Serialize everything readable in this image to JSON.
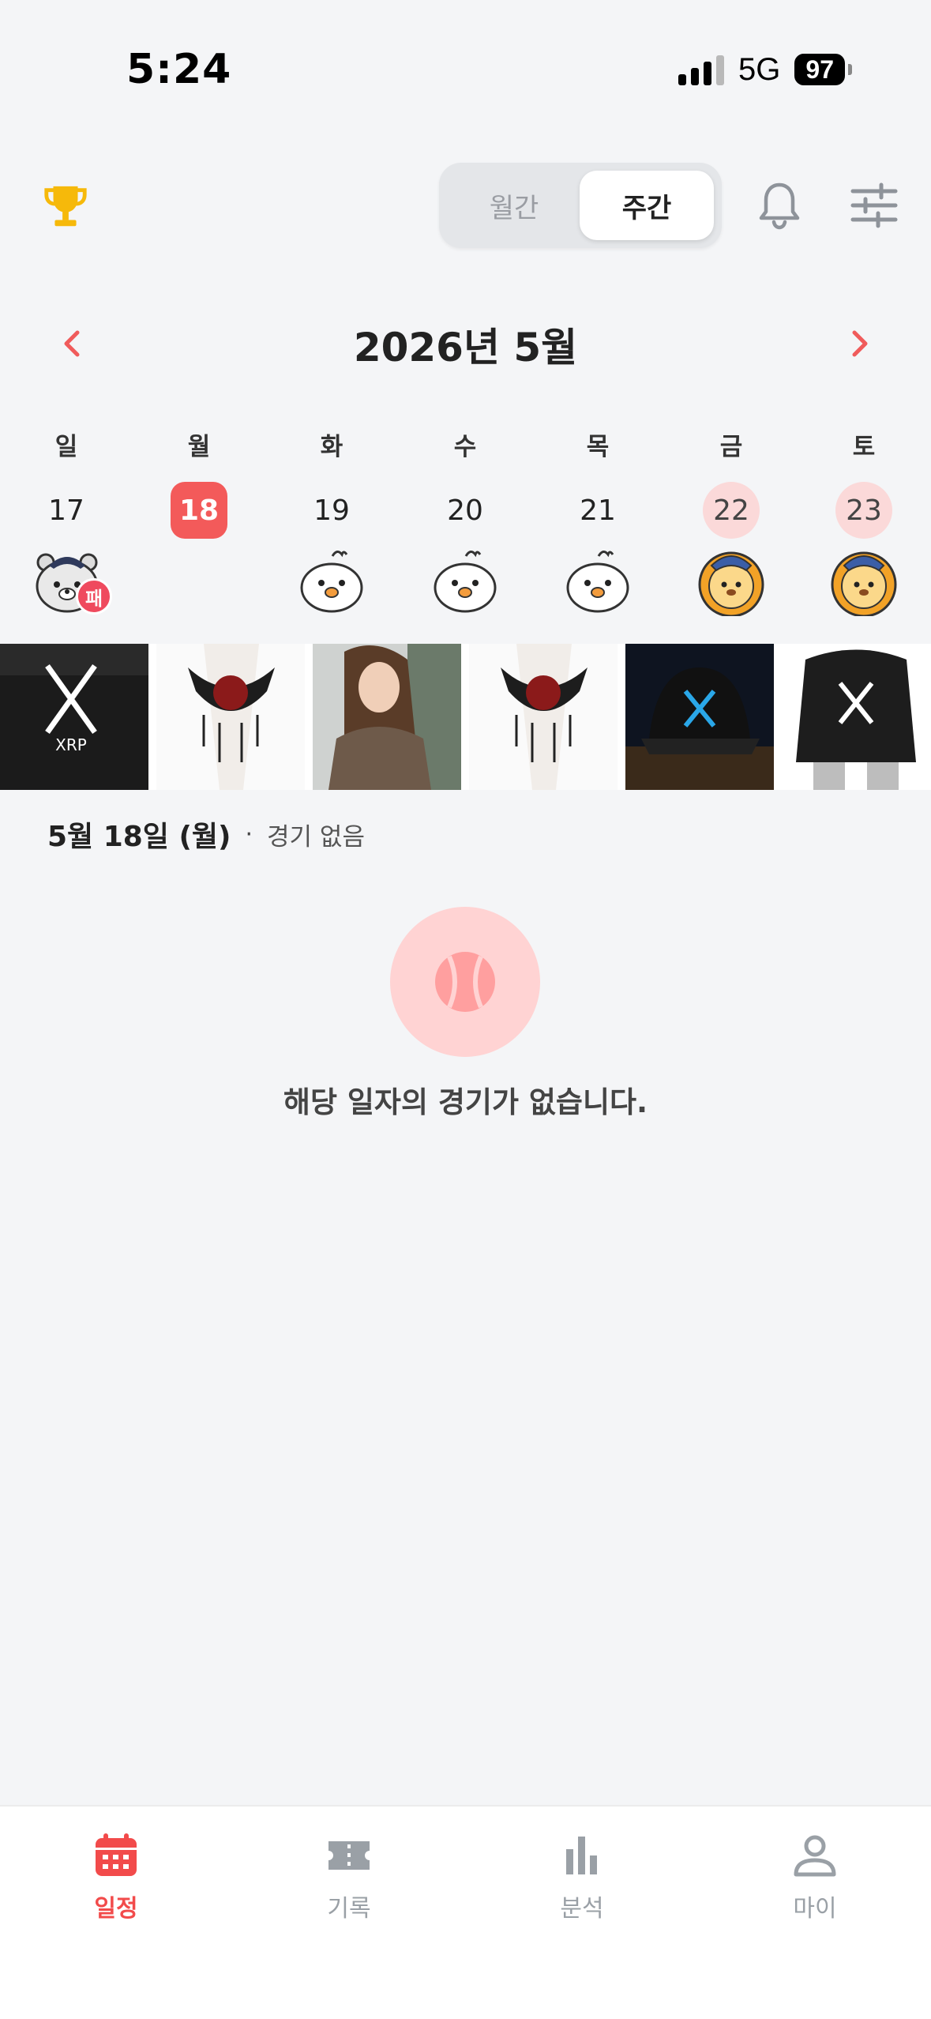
{
  "status_bar": {
    "time": "5:24",
    "network": "5G",
    "battery": "97"
  },
  "top_bar": {
    "view_toggle": {
      "monthly_label": "월간",
      "weekly_label": "주간",
      "selected": "weekly"
    }
  },
  "month_nav": {
    "title": "2026년 5월"
  },
  "week": {
    "weekdays": [
      "일",
      "월",
      "화",
      "수",
      "목",
      "금",
      "토"
    ],
    "dates": [
      "17",
      "18",
      "19",
      "20",
      "21",
      "22",
      "23"
    ],
    "today": "18",
    "highlighted": [
      "22",
      "23"
    ],
    "mascots": [
      "bear",
      "",
      "chick",
      "chick",
      "chick",
      "lion",
      "lion"
    ],
    "result_badge": {
      "date": "17",
      "label": "패"
    }
  },
  "ad_strip": {
    "items": [
      "xrp-hoodie",
      "lace-choker",
      "woman-sweater",
      "lace-choker",
      "xrp-cap",
      "xrp-hoodie-2"
    ]
  },
  "selected_day": {
    "date_label": "5월 18일 (월)",
    "separator": "·",
    "status": "경기 없음"
  },
  "empty_state": {
    "icon": "baseball-icon",
    "message": "해당 일자의 경기가 없습니다."
  },
  "bottom_nav": {
    "tabs": [
      {
        "label": "일정",
        "icon": "calendar-icon",
        "active": true
      },
      {
        "label": "기록",
        "icon": "ticket-icon",
        "active": false
      },
      {
        "label": "분석",
        "icon": "bar-chart-icon",
        "active": false
      },
      {
        "label": "마이",
        "icon": "person-icon",
        "active": false
      }
    ]
  },
  "colors": {
    "accent": "#f35a5a",
    "highlight": "#fbd9d9",
    "background": "#f4f5f7",
    "trophy": "#f6b90a",
    "loss_badge": "#ef4a5e"
  }
}
